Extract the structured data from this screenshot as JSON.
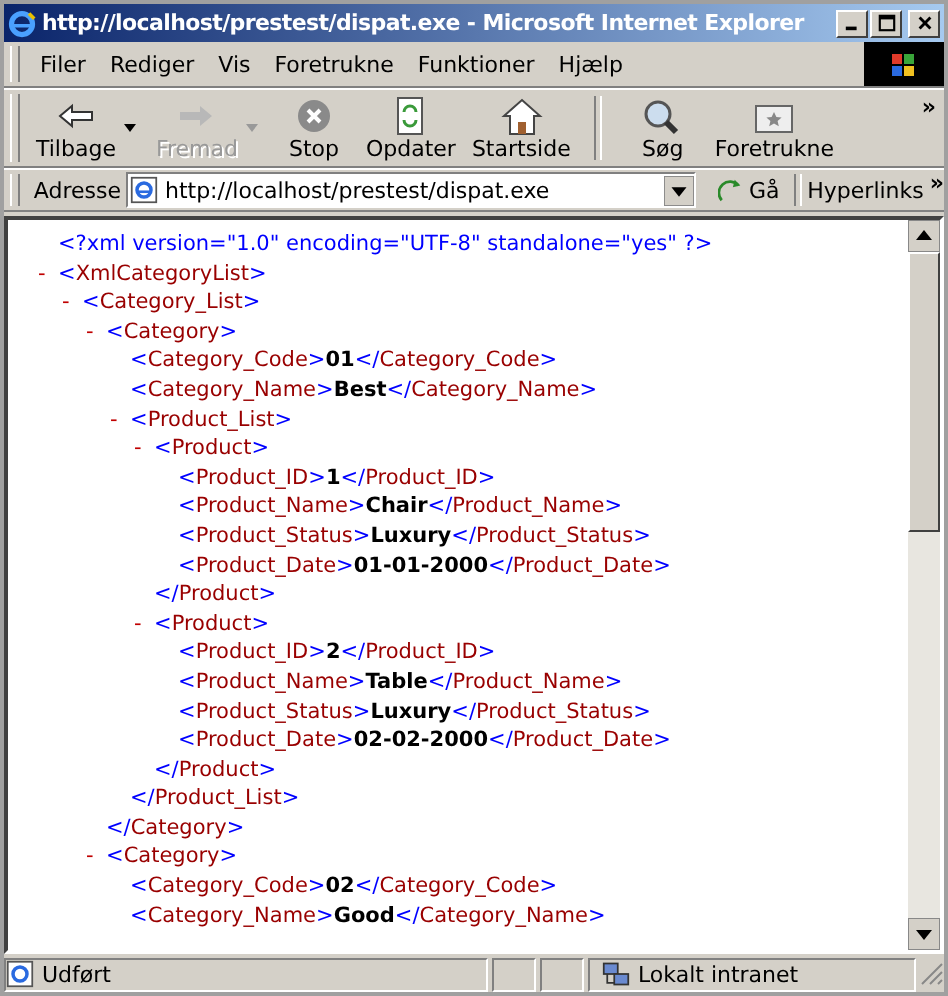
{
  "window": {
    "title": "http://localhost/prestest/dispat.exe - Microsoft Internet Explorer"
  },
  "menu": [
    "Filer",
    "Rediger",
    "Vis",
    "Foretrukne",
    "Funktioner",
    "Hjælp"
  ],
  "toolbar": [
    {
      "label": "Tilbage",
      "kind": "back",
      "disabled": false,
      "dropdown": true
    },
    {
      "label": "Fremad",
      "kind": "forward",
      "disabled": true,
      "dropdown": true
    },
    {
      "label": "Stop",
      "kind": "stop",
      "disabled": false,
      "dropdown": false
    },
    {
      "label": "Opdater",
      "kind": "refresh",
      "disabled": false,
      "dropdown": false
    },
    {
      "label": "Startside",
      "kind": "home",
      "disabled": false,
      "dropdown": false
    },
    {
      "label": "Søg",
      "kind": "search",
      "disabled": false,
      "dropdown": false
    },
    {
      "label": "Foretrukne",
      "kind": "favorites",
      "disabled": false,
      "dropdown": false
    }
  ],
  "toolbar_more": "»",
  "address_bar": {
    "label": "Adresse",
    "value": "http://localhost/prestest/dispat.exe",
    "go": "Gå",
    "links": "Hyperlinks",
    "links_more": "»"
  },
  "document": {
    "declaration": "<?xml version=\"1.0\" encoding=\"UTF-8\" standalone=\"yes\" ?>",
    "tree": [
      {
        "kind": "element",
        "toggle": "-",
        "tag": "<XmlCategoryList>",
        "children": [
          {
            "kind": "element",
            "toggle": "-",
            "tag": "<Category_List>",
            "children": [
              {
                "kind": "element",
                "toggle": "-",
                "tag": "<Category>",
                "close": "</Category>",
                "children": [
                  {
                    "kind": "leaf",
                    "tag": "<Category_Code>",
                    "value": "01",
                    "close": "</Category_Code>"
                  },
                  {
                    "kind": "leaf",
                    "tag": "<Category_Name>",
                    "value": "Best",
                    "close": "</Category_Name>"
                  },
                  {
                    "kind": "element",
                    "toggle": "-",
                    "tag": "<Product_List>",
                    "close": "</Product_List>",
                    "children": [
                      {
                        "kind": "element",
                        "toggle": "-",
                        "tag": "<Product>",
                        "close": "</Product>",
                        "children": [
                          {
                            "kind": "leaf",
                            "tag": "<Product_ID>",
                            "value": "1",
                            "close": "</Product_ID>"
                          },
                          {
                            "kind": "leaf",
                            "tag": "<Product_Name>",
                            "value": "Chair",
                            "close": "</Product_Name>"
                          },
                          {
                            "kind": "leaf",
                            "tag": "<Product_Status>",
                            "value": "Luxury",
                            "close": "</Product_Status>"
                          },
                          {
                            "kind": "leaf",
                            "tag": "<Product_Date>",
                            "value": "01-01-2000",
                            "close": "</Product_Date>"
                          }
                        ]
                      },
                      {
                        "kind": "element",
                        "toggle": "-",
                        "tag": "<Product>",
                        "close": "</Product>",
                        "children": [
                          {
                            "kind": "leaf",
                            "tag": "<Product_ID>",
                            "value": "2",
                            "close": "</Product_ID>"
                          },
                          {
                            "kind": "leaf",
                            "tag": "<Product_Name>",
                            "value": "Table",
                            "close": "</Product_Name>"
                          },
                          {
                            "kind": "leaf",
                            "tag": "<Product_Status>",
                            "value": "Luxury",
                            "close": "</Product_Status>"
                          },
                          {
                            "kind": "leaf",
                            "tag": "<Product_Date>",
                            "value": "02-02-2000",
                            "close": "</Product_Date>"
                          }
                        ]
                      }
                    ]
                  }
                ]
              },
              {
                "kind": "element",
                "toggle": "-",
                "tag": "<Category>",
                "children": [
                  {
                    "kind": "leaf",
                    "tag": "<Category_Code>",
                    "value": "02",
                    "close": "</Category_Code>"
                  },
                  {
                    "kind": "leaf",
                    "tag": "<Category_Name>",
                    "value": "Good",
                    "close": "</Category_Name>"
                  }
                ]
              }
            ]
          }
        ]
      }
    ]
  },
  "status_bar": {
    "text": "Udført",
    "zone": "Lokalt intranet"
  }
}
